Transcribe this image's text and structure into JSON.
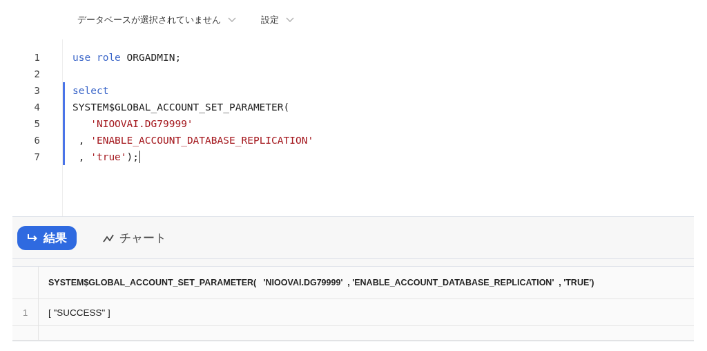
{
  "toolbar": {
    "items": [
      {
        "label": "データベースが選択されていません"
      },
      {
        "label": "設定"
      }
    ]
  },
  "editor": {
    "lines": [
      {
        "number": "1",
        "active": false,
        "cursor": false,
        "tokens": [
          {
            "kind": "keyword",
            "text": "use role"
          },
          {
            "kind": "plain",
            "text": " ORGADMIN;"
          }
        ]
      },
      {
        "number": "2",
        "active": false,
        "cursor": false
      },
      {
        "number": "3",
        "active": true,
        "cursor": false,
        "tokens": [
          {
            "kind": "keyword",
            "text": "select"
          }
        ]
      },
      {
        "number": "4",
        "active": true,
        "cursor": false,
        "tokens": [
          {
            "kind": "plain",
            "text": "SYSTEM$GLOBAL_ACCOUNT_SET_PARAMETER("
          }
        ]
      },
      {
        "number": "5",
        "active": true,
        "cursor": false,
        "tokens": [
          {
            "kind": "string",
            "text": "   'NIOOVAI.DG79999'"
          }
        ]
      },
      {
        "number": "6",
        "active": true,
        "cursor": false,
        "tokens": [
          {
            "kind": "plain",
            "text": " , "
          },
          {
            "kind": "string",
            "text": "'ENABLE_ACCOUNT_DATABASE_REPLICATION'"
          }
        ]
      },
      {
        "number": "7",
        "active": true,
        "cursor": true,
        "tokens": [
          {
            "kind": "plain",
            "text": " , "
          },
          {
            "kind": "string",
            "text": "'true'"
          },
          {
            "kind": "plain",
            "text": ");"
          }
        ]
      }
    ]
  },
  "results": {
    "tabs": [
      {
        "label": "結果",
        "selected": true,
        "kind": "results"
      },
      {
        "label": "チャート",
        "selected": false,
        "kind": "chart"
      }
    ],
    "table": {
      "columns": [
        "SYSTEM$GLOBAL_ACCOUNT_SET_PARAMETER(   'NIOOVAI.DG79999'  , 'ENABLE_ACCOUNT_DATABASE_REPLICATION'  , 'TRUE')"
      ],
      "rows": [
        {
          "number": "1",
          "cells": [
            "[ \"SUCCESS\" ]"
          ]
        }
      ]
    }
  }
}
